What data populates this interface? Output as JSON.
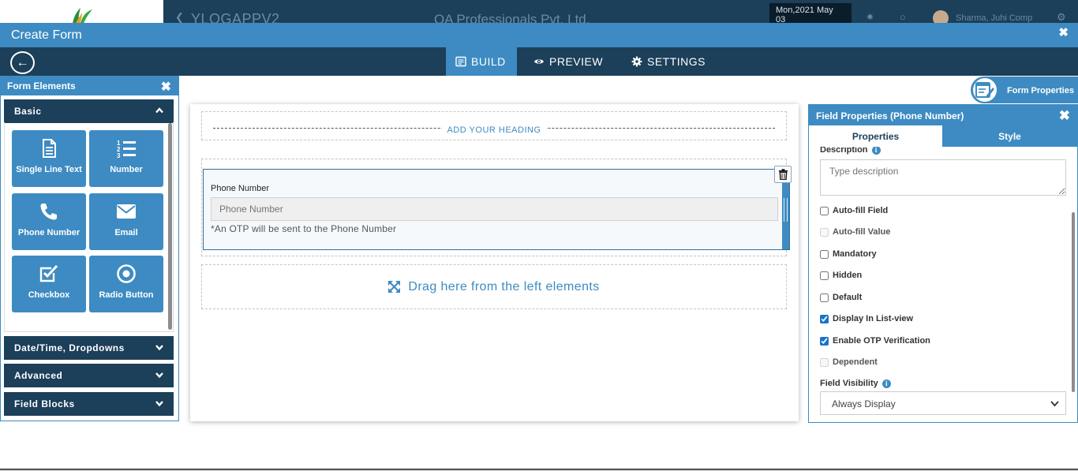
{
  "background_app": {
    "app_name": "YLOGAPPV2",
    "company": "QA Professionals Pvt. Ltd.",
    "date": "Mon,2021 May 03",
    "user": "Sharma, Juhi Comp"
  },
  "window": {
    "title": "Create Form"
  },
  "tabs": {
    "build": "BUILD",
    "preview": "PREVIEW",
    "settings": "SETTINGS",
    "active": "BUILD"
  },
  "form_elements": {
    "title": "Form Elements",
    "groups": {
      "basic": "Basic",
      "datetime": "Date/Time, Dropdowns",
      "advanced": "Advanced",
      "field_blocks": "Field Blocks"
    },
    "basic_items": [
      {
        "label": "Single Line Text",
        "icon": "document-icon"
      },
      {
        "label": "Number",
        "icon": "numbered-list-icon"
      },
      {
        "label": "Phone Number",
        "icon": "phone-icon"
      },
      {
        "label": "Email",
        "icon": "envelope-icon"
      },
      {
        "label": "Checkbox",
        "icon": "checkbox-icon"
      },
      {
        "label": "Radio Button",
        "icon": "radio-icon"
      }
    ]
  },
  "canvas": {
    "heading_placeholder": "ADD YOUR HEADING",
    "field": {
      "label": "Phone Number",
      "placeholder": "Phone Number",
      "help": "*An OTP will be sent to the Phone Number"
    },
    "drop_hint": "Drag here from the left elements"
  },
  "form_properties": {
    "label": "Form Properties"
  },
  "field_properties": {
    "title": "Field Properties (Phone Number)",
    "tab_properties": "Properties",
    "tab_style": "Style",
    "description_label": "Description",
    "description_placeholder": "Type description",
    "options": [
      {
        "label": "Auto-fill Field",
        "checked": false,
        "disabled": false
      },
      {
        "label": "Auto-fill Value",
        "checked": false,
        "disabled": true
      },
      {
        "label": "Mandatory",
        "checked": false,
        "disabled": false
      },
      {
        "label": "Hidden",
        "checked": false,
        "disabled": false
      },
      {
        "label": "Default",
        "checked": false,
        "disabled": false
      },
      {
        "label": "Display In List-view",
        "checked": true,
        "disabled": false
      },
      {
        "label": "Enable OTP Verification",
        "checked": true,
        "disabled": false
      },
      {
        "label": "Dependent",
        "checked": false,
        "disabled": true
      }
    ],
    "visibility_label": "Field Visibility",
    "visibility_value": "Always Display"
  },
  "colors": {
    "primary": "#3d8bc2",
    "dark": "#1c3f5a",
    "check_accent": "#1a73c9"
  }
}
